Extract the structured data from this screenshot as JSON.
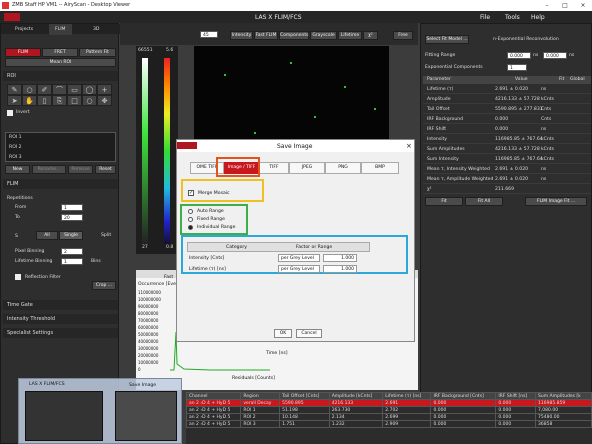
{
  "window": {
    "title": "ZMB Staff HP VM1 -- AiryScan - Desktop Viewer"
  },
  "appbar": {
    "center_title": "LAS X FLIM/FCS",
    "menu": [
      "File",
      "Tools",
      "Help"
    ]
  },
  "left": {
    "tabs": [
      "Projects",
      "FLIM",
      "3D"
    ],
    "mode_buttons": [
      "FLIM",
      "FRET",
      "Pattern Fit"
    ],
    "mean_roi": "Mean ROI",
    "roi_section": "ROI",
    "invert": "Invert",
    "roi_list": [
      "ROI 1",
      "ROI 2",
      "ROI 3"
    ],
    "roi_buttons": [
      "New",
      "Rename...",
      "Remove",
      "Reset"
    ],
    "flim_section": "FLIM",
    "repetitions": "Repetitions",
    "from_label": "From",
    "from_value": "1",
    "to_label": "To",
    "to_value": "20",
    "repeat_s": "S",
    "all_btn": "All",
    "single_btn": "Single",
    "split": "Split",
    "pixel_binning": "Pixel Binning",
    "pixel_binning_value": "2",
    "lifetime_binning": "Lifetime Binning",
    "lifetime_binning_value": "1",
    "bins": "Bins",
    "reflection_filter": "Reflection Filter",
    "crop": "Crop ...",
    "sections": [
      "Time Gate",
      "Intensity Threshold",
      "Specialist Settings"
    ]
  },
  "toolbar": {
    "zoom": "45",
    "buttons": [
      "Intensity",
      "Fast FLIM",
      "Components",
      "Grayscale",
      "Lifetime",
      "χ²",
      "Free"
    ]
  },
  "colorbar": {
    "top_left": "66551",
    "top_right": "5.6",
    "bottom_left": "27",
    "bottom_right": "0.8"
  },
  "right": {
    "select_fit": "Select Fit Model ...",
    "model": "n-Exponential Reconvolution",
    "fitting_range": "Fitting Range",
    "range_from": "0.000",
    "range_to": "0.000",
    "unit_ns": "ns",
    "exp_components": "Exponential Components",
    "exp_value": "1",
    "table_headers": [
      "Parameter",
      "Value",
      "Fit",
      "Global"
    ],
    "params": [
      {
        "name": "Lifetime (τ)",
        "value": "2.691 ± 0.020",
        "unit": "ns"
      },
      {
        "name": "Amplitude",
        "value": "4216.133 ± 57.728",
        "unit": "kCnts"
      },
      {
        "name": "Tail Offset",
        "value": "5590.895 ± 277.831",
        "unit": "Cnts"
      },
      {
        "name": "IRF Background",
        "value": "0.000",
        "unit": "Cnts"
      },
      {
        "name": "IRF Shift",
        "value": "0.000",
        "unit": "ns"
      },
      {
        "name": "Intensity",
        "value": "116985.85 ± 767.64",
        "unit": "kCnts"
      },
      {
        "name": "Sum Amplitudes",
        "value": "4216.133 ± 57.728",
        "unit": "kCnts"
      },
      {
        "name": "Sum Intensity",
        "value": "116985.85 ± 767.64",
        "unit": "kCnts"
      },
      {
        "name": "Mean τ, Intensity Weighted",
        "value": "2.691 ± 0.020",
        "unit": "ns"
      },
      {
        "name": "Mean τ, Amplitude Weighted",
        "value": "2.691 ± 0.020",
        "unit": "ns"
      },
      {
        "name": "χ²",
        "value": "211.669",
        "unit": ""
      }
    ],
    "fit_buttons": [
      "Fit",
      "Fit All",
      "FLIM Image Fit ..."
    ]
  },
  "dialog": {
    "title": "Save Image",
    "tabs": [
      "OME TIFF",
      "Image / TIFF",
      "TIFF",
      "JPEG",
      "PNG",
      "BMP"
    ],
    "merge_mosaic": "Merge Mosaic",
    "range_options": [
      "Auto Range",
      "Fixed Range",
      "Individual Range"
    ],
    "table_headers": [
      "Category",
      "Factor or Range"
    ],
    "rows": [
      {
        "label": "Intensity [Cnts]",
        "mode": "per Grey Level",
        "value": "1.000"
      },
      {
        "label": "Lifetime (τ) [ns]",
        "mode": "per Grey Level",
        "value": "1.000"
      }
    ],
    "ok": "OK",
    "cancel": "Cancel",
    "highlight_colors": [
      "#e2551a",
      "#f0c020",
      "#3fae49",
      "#2aa8d8"
    ]
  },
  "histogram": {
    "title": "Fast",
    "ylabel": "Occurrence [Even",
    "yticks": [
      "110000000",
      "100000000",
      "90000000",
      "80000000",
      "70000000",
      "60000000",
      "50000000",
      "40000000",
      "30000000",
      "20000000",
      "10000000",
      "0"
    ],
    "residual_label": "Residuals [Counts]",
    "time_label": "Time [ns]"
  },
  "taskbar": {
    "items": [
      "LAS X FLIM/FCS",
      "Save Image"
    ]
  },
  "bottom_table": {
    "headers": [
      "Channel",
      "Region",
      "Tail Offset [Cnts]",
      "Amplitude [kCnts]",
      "Lifetime (τ) [ns]",
      "IRF Background [Cnts]",
      "IRF Shift [ns]",
      "Sum Amplitudes [k"
    ],
    "rows": [
      [
        "an 2 ›D 4 + HyD 5",
        "verall Decay",
        "5590.895",
        "4216.133",
        "2.691",
        "0.000",
        "0.000",
        "116985.859"
      ],
      [
        "an 2 ›D 4 + HyD 5",
        "ROI 1",
        "51.198",
        "263.730",
        "2.702",
        "0.000",
        "0.000",
        "7,080.00"
      ],
      [
        "an 2 ›D 4 + HyD 5",
        "ROI 2",
        "10.148",
        "2.134",
        "2.699",
        "0.000",
        "0.000",
        "75480.00"
      ],
      [
        "an 2 ›D 4 + HyD 5",
        "ROI 3",
        "1.751",
        "1.232",
        "2.909",
        "0.000",
        "0.000",
        "36858"
      ]
    ]
  }
}
